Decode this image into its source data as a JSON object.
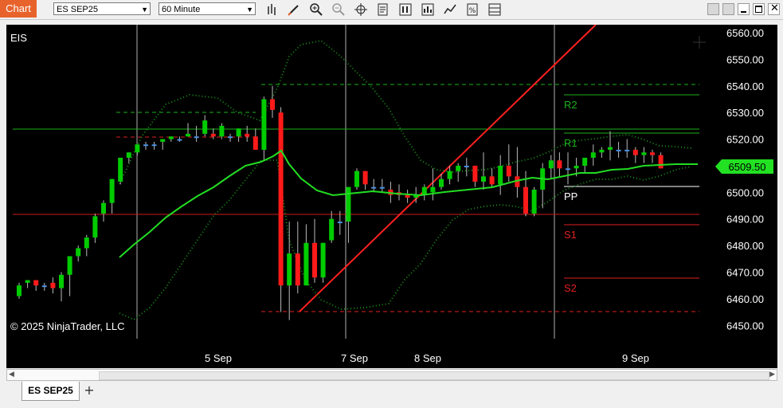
{
  "toolbar": {
    "chart_label": "Chart",
    "instrument_value": "ES SEP25",
    "interval_value": "60 Minute",
    "icons": [
      "bar-type-icon",
      "drawing-tool-icon",
      "zoom-in-icon",
      "zoom-out-icon",
      "crosshair-icon",
      "properties-icon",
      "strategies-icon",
      "indicators-icon",
      "chart-trader-icon",
      "templates-icon",
      "data-box-icon"
    ]
  },
  "window_controls": [
    "minimize",
    "restore",
    "maximize",
    "close"
  ],
  "chart": {
    "instrument_label": "EIS",
    "copyright": "© 2025 NinjaTrader, LLC",
    "last_price": "6509.50",
    "price_ticks": [
      "6560.00",
      "6550.00",
      "6540.00",
      "6530.00",
      "6520.00",
      "6510.00",
      "6500.00",
      "6490.00",
      "6480.00",
      "6470.00",
      "6460.00",
      "6450.00"
    ],
    "time_ticks": [
      "5 Sep",
      "7 Sep",
      "8 Sep",
      "9 Sep"
    ],
    "pivot_labels": [
      "R2",
      "R1",
      "PP",
      "S1",
      "S2"
    ],
    "colors": {
      "up": "#00cc00",
      "down": "#ff1a1a",
      "neutral": "#4a90e2",
      "ma": "#22dd22",
      "band": "#1a8c1a",
      "trend": "#ff2020",
      "price_tag": "#22e022"
    }
  },
  "chart_data": {
    "type": "candlestick",
    "ylim": [
      6445,
      6563
    ],
    "candles": [
      [
        6461,
        6466,
        6460,
        6465
      ],
      [
        6466,
        6467,
        6464,
        6467
      ],
      [
        6467,
        6465,
        6463,
        6465
      ],
      [
        6465,
        6466,
        6463,
        6465
      ],
      [
        6466,
        6468,
        6462,
        6464
      ],
      [
        6464,
        6470,
        6459,
        6469
      ],
      [
        6469,
        6475,
        6461,
        6476
      ],
      [
        6476,
        6480,
        6474,
        6479
      ],
      [
        6479,
        6484,
        6476,
        6483
      ],
      [
        6483,
        6492,
        6481,
        6491
      ],
      [
        6492,
        6497,
        6489,
        6496
      ],
      [
        6496,
        6504,
        6492,
        6505
      ],
      [
        6504,
        6513,
        6503,
        6513
      ],
      [
        6513,
        6515,
        6511,
        6515
      ],
      [
        6515,
        6518,
        6514,
        6518
      ],
      [
        6518,
        6519,
        6516,
        6518
      ],
      [
        6518,
        6519,
        6516,
        6518
      ],
      [
        6519,
        6520,
        6516,
        6520
      ],
      [
        6520,
        6521,
        6519,
        6521
      ],
      [
        6520,
        6521,
        6519,
        6520
      ],
      [
        6521,
        6526,
        6521,
        6522
      ],
      [
        6521,
        6525,
        6519,
        6521
      ],
      [
        6522,
        6529,
        6521,
        6527
      ],
      [
        6522,
        6524,
        6520,
        6521
      ],
      [
        6521,
        6526,
        6520,
        6525
      ],
      [
        6521,
        6522,
        6519,
        6521
      ],
      [
        6521,
        6523,
        6519,
        6524
      ],
      [
        6522,
        6525,
        6519,
        6521
      ],
      [
        6521,
        6524,
        6517,
        6516
      ],
      [
        6516,
        6536,
        6512,
        6535
      ],
      [
        6535,
        6540,
        6528,
        6531
      ],
      [
        6530,
        6532,
        6455,
        6465
      ],
      [
        6465,
        6489,
        6452,
        6477
      ],
      [
        6477,
        6489,
        6462,
        6465
      ],
      [
        6465,
        6488,
        6474,
        6481
      ],
      [
        6481,
        6490,
        6466,
        6468
      ],
      [
        6468,
        6479,
        6466,
        6481
      ],
      [
        6482,
        6493,
        6481,
        6490
      ],
      [
        6489,
        6493,
        6484,
        6489
      ],
      [
        6489,
        6502,
        6481,
        6502
      ],
      [
        6502,
        6509,
        6501,
        6508
      ],
      [
        6508,
        6508,
        6501,
        6503
      ],
      [
        6502,
        6505,
        6500,
        6502
      ],
      [
        6502,
        6505,
        6500,
        6502
      ],
      [
        6501,
        6504,
        6496,
        6499
      ],
      [
        6500,
        6503,
        6497,
        6499
      ],
      [
        6499,
        6501,
        6496,
        6498
      ],
      [
        6498,
        6502,
        6496,
        6499
      ],
      [
        6499,
        6503,
        6497,
        6502
      ],
      [
        6500,
        6509,
        6497,
        6502
      ],
      [
        6502,
        6507,
        6501,
        6505
      ],
      [
        6505,
        6510,
        6503,
        6508
      ],
      [
        6508,
        6511,
        6504,
        6510
      ],
      [
        6510,
        6513,
        6506,
        6510
      ],
      [
        6510,
        6509,
        6502,
        6504
      ],
      [
        6504,
        6515,
        6501,
        6506
      ],
      [
        6506,
        6509,
        6502,
        6503
      ],
      [
        6503,
        6514,
        6499,
        6510
      ],
      [
        6510,
        6518,
        6504,
        6506
      ],
      [
        6506,
        6517,
        6498,
        6502
      ],
      [
        6502,
        6508,
        6491,
        6492
      ],
      [
        6492,
        6502,
        6491,
        6501
      ],
      [
        6501,
        6511,
        6494,
        6509
      ],
      [
        6509,
        6514,
        6505,
        6512
      ],
      [
        6512,
        6515,
        6506,
        6509
      ],
      [
        6509,
        6515,
        6503,
        6509
      ],
      [
        6509,
        6513,
        6506,
        6510
      ],
      [
        6510,
        6513,
        6507,
        6513
      ],
      [
        6513,
        6518,
        6510,
        6515
      ],
      [
        6515,
        6517,
        6513,
        6516
      ],
      [
        6516,
        6523,
        6512,
        6517
      ],
      [
        6516,
        6519,
        6513,
        6516
      ],
      [
        6516,
        6520,
        6513,
        6516
      ],
      [
        6516,
        6517,
        6511,
        6514
      ],
      [
        6514,
        6517,
        6511,
        6515
      ],
      [
        6515,
        6516,
        6511,
        6514
      ],
      [
        6514,
        6515,
        6511,
        6509
      ]
    ]
  }
}
